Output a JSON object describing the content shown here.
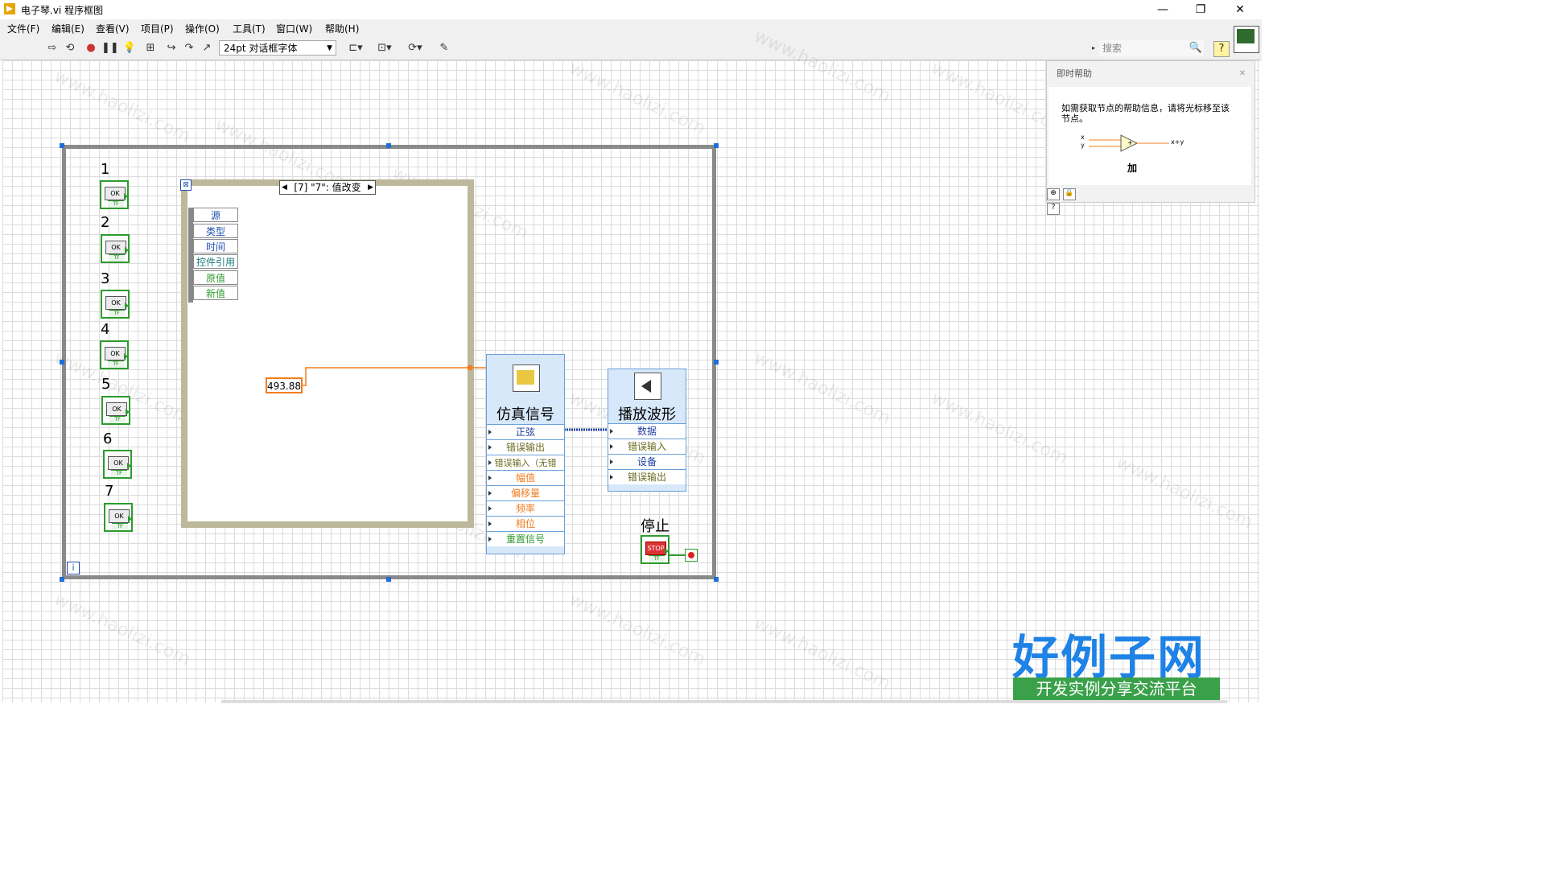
{
  "window": {
    "title": "电子琴.vi 程序框图",
    "minimize": "—",
    "restore": "❐",
    "close": "✕"
  },
  "menu": [
    "文件(F)",
    "编辑(E)",
    "查看(V)",
    "项目(P)",
    "操作(O)",
    "工具(T)",
    "窗口(W)",
    "帮助(H)"
  ],
  "toolbar": {
    "font_selector": "24pt 对话框字体",
    "search_placeholder": "搜索"
  },
  "diagram": {
    "button_labels": [
      "1",
      "2",
      "3",
      "4",
      "5",
      "6",
      "7"
    ],
    "button_text": "OK",
    "tf_text": "TF",
    "event_case": "[7] \"7\": 值改变",
    "event_data_fields": [
      "源",
      "类型",
      "时间",
      "控件引用",
      "原值",
      "新值"
    ],
    "numeric_constant": "493.88",
    "simulate_signal": {
      "title": "仿真信号",
      "terminals": [
        "正弦",
        "错误输出",
        "错误输入（无错",
        "幅值",
        "偏移量",
        "频率",
        "相位",
        "重置信号"
      ]
    },
    "play_waveform": {
      "title": "播放波形",
      "terminals": [
        "数据",
        "错误输入",
        "设备",
        "错误输出"
      ]
    },
    "stop_label": "停止",
    "stop_button_text": "STOP",
    "iteration_terminal": "i"
  },
  "context_help": {
    "title": "即时帮助",
    "message": "如需获取节点的帮助信息，请将光标移至该节点。",
    "node_name": "加",
    "input_x": "x",
    "input_y": "y",
    "output": "x+y"
  },
  "watermark": {
    "text": "www.haolizi.com",
    "brand_main": "好例子网",
    "brand_sub": "开发实例分享交流平台"
  },
  "colors": {
    "boolean_green": "#2d9b2d",
    "numeric_orange": "#f07d1e",
    "express_blue": "#d7e8fb",
    "selection_blue": "#1e6fd9",
    "brand_blue": "#1e82e6",
    "brand_green": "#3aa14a"
  }
}
